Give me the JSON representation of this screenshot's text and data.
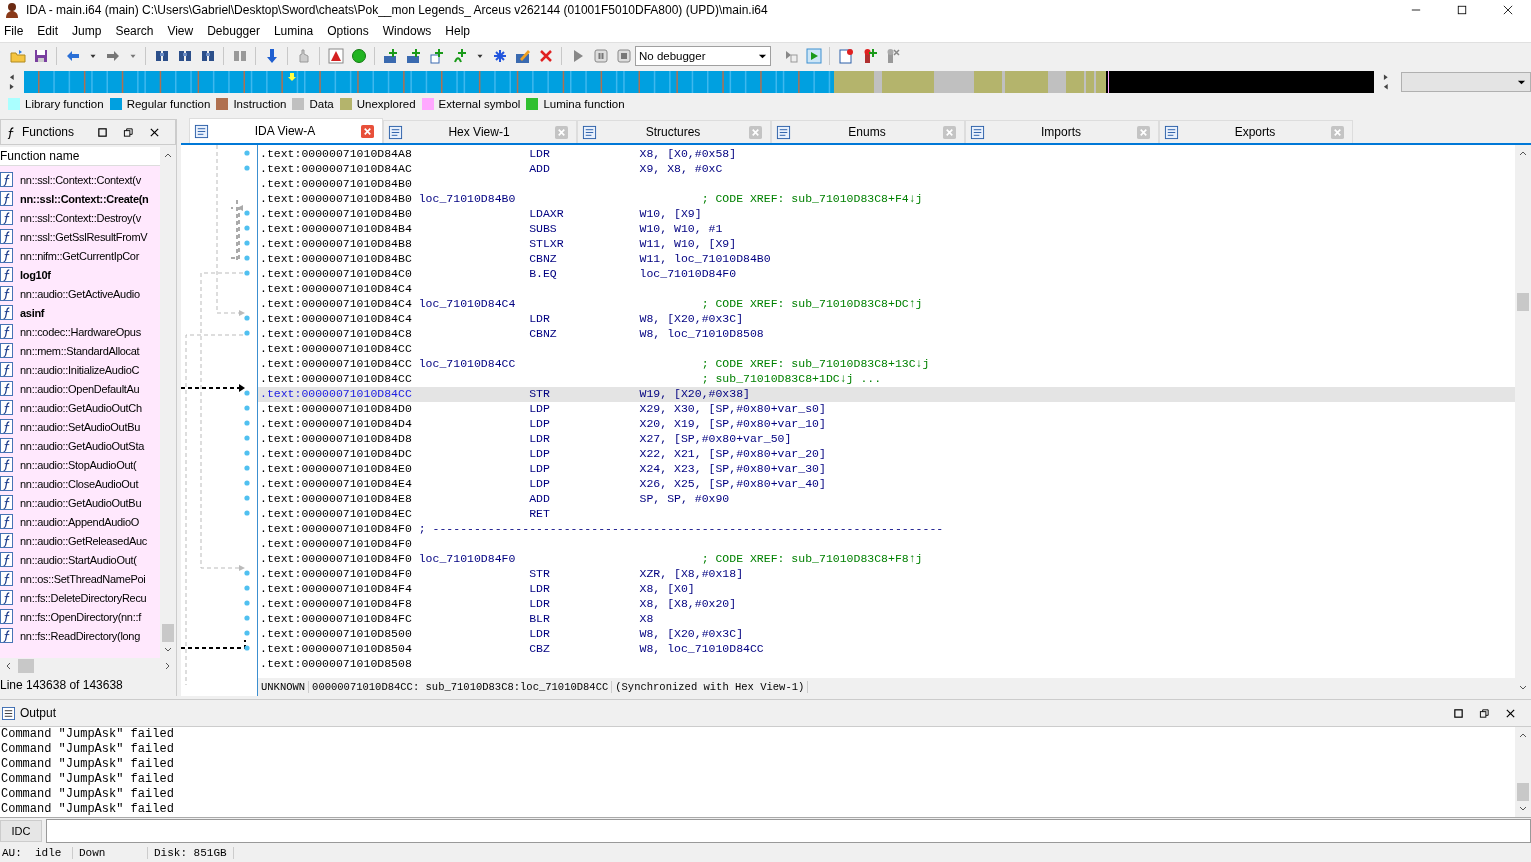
{
  "window": {
    "title": "IDA - main.i64 (main) C:\\Users\\Gabriel\\Desktop\\Sword\\cheats\\Pok__mon Legends_ Arceus v262144 (01001F5010DFA800) (UPD)\\main.i64"
  },
  "menu": [
    "File",
    "Edit",
    "Jump",
    "Search",
    "View",
    "Debugger",
    "Lumina",
    "Options",
    "Windows",
    "Help"
  ],
  "debugger_select": {
    "value": "No debugger"
  },
  "legend": [
    {
      "label": "Library function",
      "color": "#aaffff"
    },
    {
      "label": "Regular function",
      "color": "#00a0e0"
    },
    {
      "label": "Instruction",
      "color": "#b07050"
    },
    {
      "label": "Data",
      "color": "#c0c0c0"
    },
    {
      "label": "Unexplored",
      "color": "#b4b46c"
    },
    {
      "label": "External symbol",
      "color": "#ffa8ff"
    },
    {
      "label": "Lumina function",
      "color": "#30c030"
    }
  ],
  "functions_panel": {
    "title": "Functions",
    "column": "Function name",
    "status": "Line 143638 of 143638",
    "items": [
      {
        "name": "nn::ssl::Context::Context(v",
        "bold": false
      },
      {
        "name": "nn::ssl::Context::Create(n",
        "bold": true
      },
      {
        "name": "nn::ssl::Context::Destroy(v",
        "bold": false
      },
      {
        "name": "nn::ssl::GetSslResultFromV",
        "bold": false
      },
      {
        "name": "nn::nifm::GetCurrentIpCor",
        "bold": false
      },
      {
        "name": "log10f",
        "bold": true
      },
      {
        "name": "nn::audio::GetActiveAudio",
        "bold": false
      },
      {
        "name": "asinf",
        "bold": true
      },
      {
        "name": "nn::codec::HardwareOpus",
        "bold": false
      },
      {
        "name": "nn::mem::StandardAllocat",
        "bold": false
      },
      {
        "name": "nn::audio::InitializeAudioC",
        "bold": false
      },
      {
        "name": "nn::audio::OpenDefaultAu",
        "bold": false
      },
      {
        "name": "nn::audio::GetAudioOutCh",
        "bold": false
      },
      {
        "name": "nn::audio::SetAudioOutBu",
        "bold": false
      },
      {
        "name": "nn::audio::GetAudioOutSta",
        "bold": false
      },
      {
        "name": "nn::audio::StopAudioOut(",
        "bold": false
      },
      {
        "name": "nn::audio::CloseAudioOut",
        "bold": false
      },
      {
        "name": "nn::audio::GetAudioOutBu",
        "bold": false
      },
      {
        "name": "nn::audio::AppendAudioO",
        "bold": false
      },
      {
        "name": "nn::audio::GetReleasedAuc",
        "bold": false
      },
      {
        "name": "nn::audio::StartAudioOut(",
        "bold": false
      },
      {
        "name": "nn::os::SetThreadNamePoi",
        "bold": false
      },
      {
        "name": "nn::fs::DeleteDirectoryRecu",
        "bold": false
      },
      {
        "name": "nn::fs::OpenDirectory(nn::f",
        "bold": false
      },
      {
        "name": "nn::fs::ReadDirectory(long",
        "bold": false
      }
    ]
  },
  "tabs": [
    {
      "label": "IDA View-A",
      "selected": true
    },
    {
      "label": "Hex View-1",
      "selected": false
    },
    {
      "label": "Structures",
      "selected": false
    },
    {
      "label": "Enums",
      "selected": false
    },
    {
      "label": "Imports",
      "selected": false
    },
    {
      "label": "Exports",
      "selected": false
    }
  ],
  "lines": [
    {
      "kind": "instr",
      "address": ".text:00000071010D84A8",
      "mnemonic": "LDR",
      "operands": "X8, [X0,#0x58]",
      "selected": false
    },
    {
      "kind": "instr",
      "address": ".text:00000071010D84AC",
      "mnemonic": "ADD",
      "operands": "X9, X8, #0xC",
      "selected": false
    },
    {
      "kind": "blank",
      "address": ".text:00000071010D84B0",
      "selected": false
    },
    {
      "kind": "label",
      "address": ".text:00000071010D84B0",
      "label": "loc_71010D84B0",
      "comment": "; CODE XREF: sub_71010D83C8+F4↓j",
      "selected": false
    },
    {
      "kind": "instr",
      "address": ".text:00000071010D84B0",
      "mnemonic": "LDAXR",
      "operands": "W10, [X9]",
      "selected": false
    },
    {
      "kind": "instr",
      "address": ".text:00000071010D84B4",
      "mnemonic": "SUBS",
      "operands": "W10, W10, #1",
      "selected": false
    },
    {
      "kind": "instr",
      "address": ".text:00000071010D84B8",
      "mnemonic": "STLXR",
      "operands": "W11, W10, [X9]",
      "selected": false
    },
    {
      "kind": "instr",
      "address": ".text:00000071010D84BC",
      "mnemonic": "CBNZ",
      "operands": "W11, loc_71010D84B0",
      "selected": false
    },
    {
      "kind": "instr",
      "address": ".text:00000071010D84C0",
      "mnemonic": "B.EQ",
      "operands": "loc_71010D84F0",
      "selected": false
    },
    {
      "kind": "blank",
      "address": ".text:00000071010D84C4",
      "selected": false
    },
    {
      "kind": "label",
      "address": ".text:00000071010D84C4",
      "label": "loc_71010D84C4",
      "comment": "; CODE XREF: sub_71010D83C8+DC↑j",
      "selected": false
    },
    {
      "kind": "instr",
      "address": ".text:00000071010D84C4",
      "mnemonic": "LDR",
      "operands": "W8, [X20,#0x3C]",
      "selected": false
    },
    {
      "kind": "instr",
      "address": ".text:00000071010D84C8",
      "mnemonic": "CBNZ",
      "operands": "W8, loc_71010D8508",
      "selected": false
    },
    {
      "kind": "blank",
      "address": ".text:00000071010D84CC",
      "selected": false
    },
    {
      "kind": "label",
      "address": ".text:00000071010D84CC",
      "label": "loc_71010D84CC",
      "comment": "; CODE XREF: sub_71010D83C8+13C↓j",
      "selected": false
    },
    {
      "kind": "label",
      "address": ".text:00000071010D84CC",
      "comment": "; sub_71010D83C8+1DC↓j ...",
      "selected": false
    },
    {
      "kind": "instr",
      "address": ".text:00000071010D84CC",
      "mnemonic": "STR",
      "operands": "W19, [X20,#0x38]",
      "selected": true
    },
    {
      "kind": "instr",
      "address": ".text:00000071010D84D0",
      "mnemonic": "LDP",
      "operands": "X29, X30, [SP,#0x80+var_s0]",
      "selected": false
    },
    {
      "kind": "instr",
      "address": ".text:00000071010D84D4",
      "mnemonic": "LDP",
      "operands": "X20, X19, [SP,#0x80+var_10]",
      "selected": false
    },
    {
      "kind": "instr",
      "address": ".text:00000071010D84D8",
      "mnemonic": "LDR",
      "operands": "X27, [SP,#0x80+var_50]",
      "selected": false
    },
    {
      "kind": "instr",
      "address": ".text:00000071010D84DC",
      "mnemonic": "LDP",
      "operands": "X22, X21, [SP,#0x80+var_20]",
      "selected": false
    },
    {
      "kind": "instr",
      "address": ".text:00000071010D84E0",
      "mnemonic": "LDP",
      "operands": "X24, X23, [SP,#0x80+var_30]",
      "selected": false
    },
    {
      "kind": "instr",
      "address": ".text:00000071010D84E4",
      "mnemonic": "LDP",
      "operands": "X26, X25, [SP,#0x80+var_40]",
      "selected": false
    },
    {
      "kind": "instr",
      "address": ".text:00000071010D84E8",
      "mnemonic": "ADD",
      "operands": "SP, SP, #0x90",
      "selected": false
    },
    {
      "kind": "instr",
      "address": ".text:00000071010D84EC",
      "mnemonic": "RET",
      "selected": false
    },
    {
      "kind": "separator",
      "address": ".text:00000071010D84F0",
      "comment": "; --------------------------------------------------------------------------",
      "selected": false
    },
    {
      "kind": "blank",
      "address": ".text:00000071010D84F0",
      "selected": false
    },
    {
      "kind": "label",
      "address": ".text:00000071010D84F0",
      "label": "loc_71010D84F0",
      "comment": "; CODE XREF: sub_71010D83C8+F8↑j",
      "selected": false
    },
    {
      "kind": "instr",
      "address": ".text:00000071010D84F0",
      "mnemonic": "STR",
      "operands": "XZR, [X8,#0x18]",
      "selected": false
    },
    {
      "kind": "instr",
      "address": ".text:00000071010D84F4",
      "mnemonic": "LDR",
      "operands": "X8, [X0]",
      "selected": false
    },
    {
      "kind": "instr",
      "address": ".text:00000071010D84F8",
      "mnemonic": "LDR",
      "operands": "X8, [X8,#0x20]",
      "selected": false
    },
    {
      "kind": "instr",
      "address": ".text:00000071010D84FC",
      "mnemonic": "BLR",
      "operands": "X8",
      "selected": false
    },
    {
      "kind": "instr",
      "address": ".text:00000071010D8500",
      "mnemonic": "LDR",
      "operands": "W8, [X20,#0x3C]",
      "selected": false
    },
    {
      "kind": "instr",
      "address": ".text:00000071010D8504",
      "mnemonic": "CBZ",
      "operands": "W8, loc_71010D84CC",
      "selected": false
    },
    {
      "kind": "blank",
      "address": ".text:00000071010D8508",
      "selected": false
    }
  ],
  "view_status": [
    "UNKNOWN",
    "00000071010D84CC: sub_71010D83C8:loc_71010D84CC",
    "(Synchronized with Hex View-1)"
  ],
  "output": {
    "title": "Output",
    "lines": [
      "Command \"JumpAsk\" failed",
      "Command \"JumpAsk\" failed",
      "Command \"JumpAsk\" failed",
      "Command \"JumpAsk\" failed",
      "Command \"JumpAsk\" failed",
      "Command \"JumpAsk\" failed"
    ]
  },
  "command_line": {
    "button": "IDC"
  },
  "status_bar": [
    "AU:  idle",
    "Down",
    "Disk: 851GB"
  ]
}
